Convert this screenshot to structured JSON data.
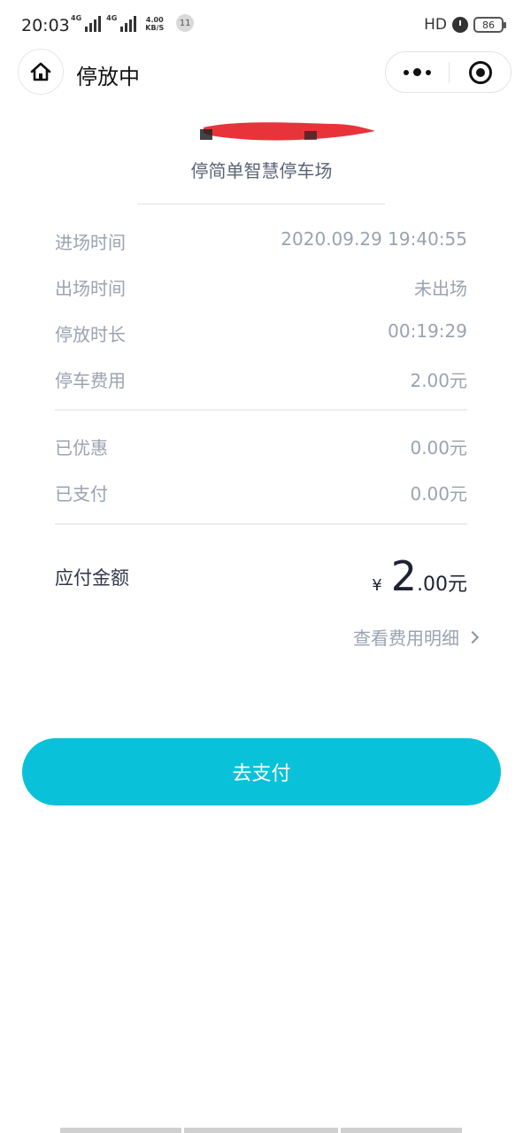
{
  "status_bar": {
    "time": "20:03",
    "signal_1_label": "4G",
    "signal_2_label": "4G",
    "net_speed_value": "4.00",
    "net_speed_unit": "KB/S",
    "notification_count": "11",
    "hd_label": "HD",
    "battery": "86"
  },
  "nav": {
    "title": "停放中"
  },
  "parking": {
    "lot_name": "停简单智慧停车场"
  },
  "details": [
    {
      "label": "进场时间",
      "value": "2020.09.29 19:40:55"
    },
    {
      "label": "出场时间",
      "value": "未出场"
    },
    {
      "label": "停放时长",
      "value": "00:19:29"
    },
    {
      "label": "停车费用",
      "value": "2.00元"
    }
  ],
  "payments": [
    {
      "label": "已优惠",
      "value": "0.00元"
    },
    {
      "label": "已支付",
      "value": "0.00元"
    }
  ],
  "amount_due": {
    "label": "应付金额",
    "currency": "¥",
    "integer": "2",
    "decimal": ".00元"
  },
  "fee_detail_link": "查看费用明细",
  "pay_button": "去支付",
  "colors": {
    "accent": "#09c2d9",
    "muted_text": "#9aa3b1",
    "redaction": "#e8333a"
  }
}
